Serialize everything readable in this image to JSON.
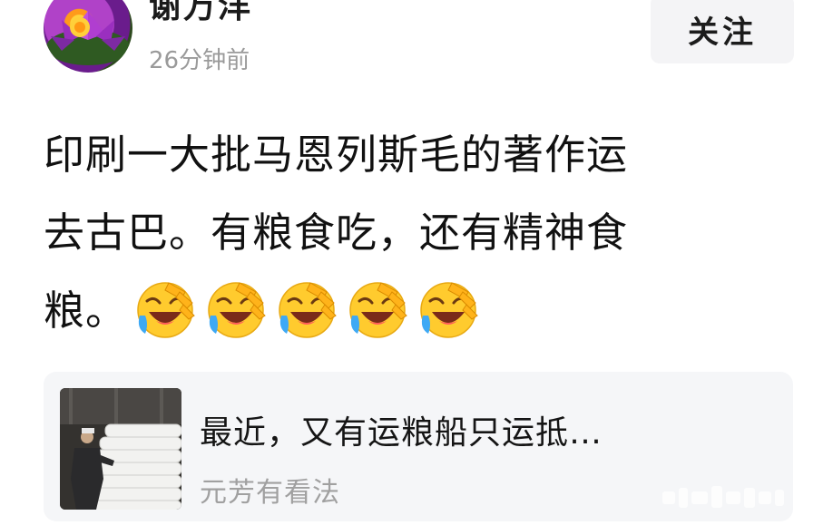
{
  "header": {
    "username": "谢万洋",
    "post_time": "26分钟前",
    "follow_label": "关注"
  },
  "post": {
    "text_lines": [
      "印刷一大批马恩列斯毛的著作运",
      "去古巴。有粮食吃，还有精神食",
      "粮。"
    ],
    "emoji_name": "laughing-crying-emoji",
    "emoji_count": 5
  },
  "link_card": {
    "title": "最近，又有运粮船只运抵…",
    "source": "元芳有看法"
  },
  "colors": {
    "follow_bg": "#f4f4f6",
    "card_bg": "#f5f6f8",
    "muted_text": "#9a9a9a",
    "emoji_yellow": "#ffcb2e"
  }
}
